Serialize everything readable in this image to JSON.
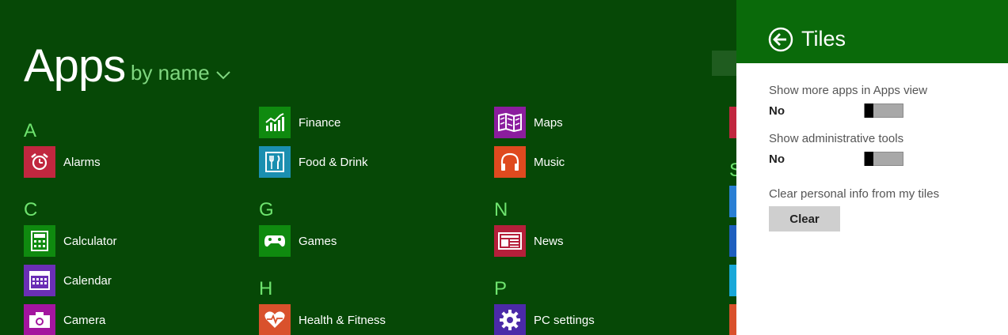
{
  "apps_view": {
    "title": "Apps",
    "sort_label": "by name",
    "groups": [
      {
        "letter": "A"
      },
      {
        "letter": "C"
      },
      {
        "letter": "G"
      },
      {
        "letter": "H"
      },
      {
        "letter": "N"
      },
      {
        "letter": "P"
      },
      {
        "letter": "S"
      }
    ],
    "apps": [
      {
        "label": "Alarms",
        "icon": "alarm-clock-icon",
        "color": "#c1273f"
      },
      {
        "label": "Calculator",
        "icon": "calculator-icon",
        "color": "#0f8a0f"
      },
      {
        "label": "Calendar",
        "icon": "calendar-icon",
        "color": "#6a2fb5"
      },
      {
        "label": "Camera",
        "icon": "camera-icon",
        "color": "#a3159e"
      },
      {
        "label": "Finance",
        "icon": "finance-chart-icon",
        "color": "#0f8a0f"
      },
      {
        "label": "Food & Drink",
        "icon": "fork-knife-icon",
        "color": "#1b8fb0"
      },
      {
        "label": "Games",
        "icon": "game-controller-icon",
        "color": "#0f8a0f"
      },
      {
        "label": "Health & Fitness",
        "icon": "heart-pulse-icon",
        "color": "#d9512c"
      },
      {
        "label": "Maps",
        "icon": "map-icon",
        "color": "#8b1d9e"
      },
      {
        "label": "Music",
        "icon": "headphones-icon",
        "color": "#df4a1f"
      },
      {
        "label": "News",
        "icon": "newspaper-icon",
        "color": "#b51f3a"
      },
      {
        "label": "PC settings",
        "icon": "gear-icon",
        "color": "#4b2aa8"
      }
    ],
    "edge_tile_colors": [
      "#c1273f",
      "#2a7fd4",
      "#1e5fbf",
      "#19a8d8",
      "#d9512c"
    ]
  },
  "settings_panel": {
    "title": "Tiles",
    "back_icon": "back-arrow-icon",
    "header_color": "#0a6a0a",
    "settings": [
      {
        "label": "Show more apps in Apps view",
        "state": "No"
      },
      {
        "label": "Show administrative tools",
        "state": "No"
      }
    ],
    "clear_section": {
      "label": "Clear personal info from my tiles",
      "button_label": "Clear"
    }
  }
}
